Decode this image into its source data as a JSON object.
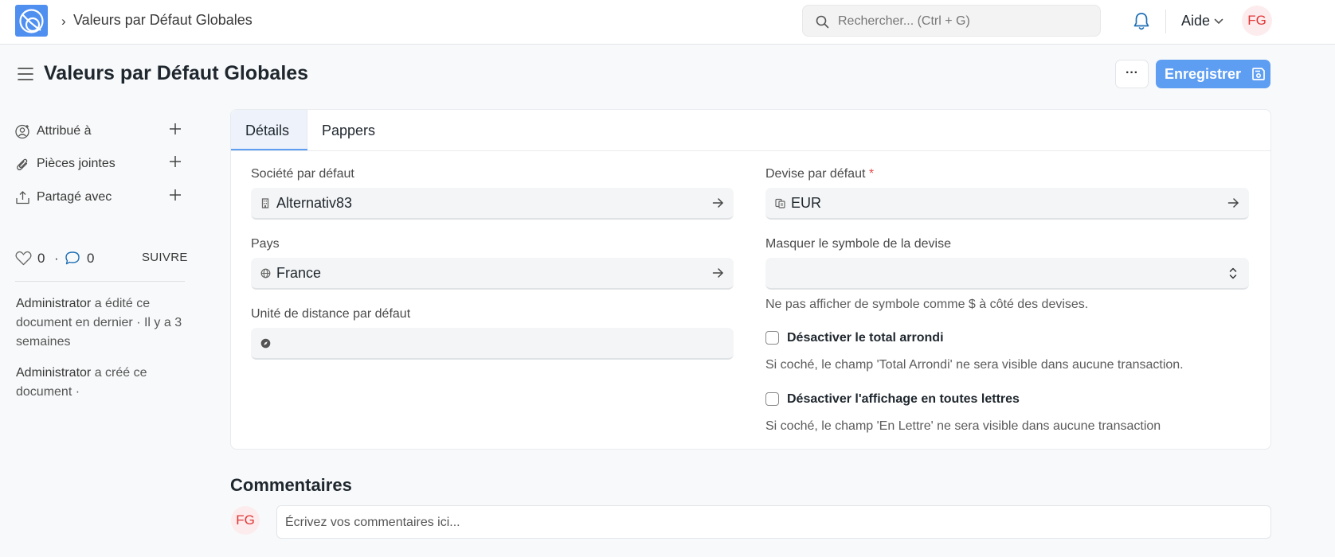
{
  "navbar": {
    "breadcrumb": "Valeurs par Défaut Globales",
    "search_placeholder": "Rechercher... (Ctrl + G)",
    "help_label": "Aide",
    "user_initials": "FG"
  },
  "header": {
    "title": "Valeurs par Défaut Globales",
    "more_label": "···",
    "save_label": "Enregistrer"
  },
  "sidebar": {
    "items": [
      {
        "label": "Attribué à"
      },
      {
        "label": "Pièces jointes"
      },
      {
        "label": "Partagé avec"
      }
    ],
    "likes_count": "0",
    "comments_count": "0",
    "follow_label": "SUIVRE",
    "activity": [
      {
        "user": "Administrator",
        "text": "a édité ce document en dernier · Il y a 3 semaines"
      },
      {
        "user": "Administrator",
        "text": "a créé ce document ·"
      }
    ]
  },
  "tabs": [
    {
      "label": "Détails",
      "active": true
    },
    {
      "label": "Pappers",
      "active": false
    }
  ],
  "form": {
    "company": {
      "label": "Société par défaut",
      "value": "Alternativ83"
    },
    "country": {
      "label": "Pays",
      "value": "France"
    },
    "distance_unit": {
      "label": "Unité de distance par défaut",
      "value": ""
    },
    "currency": {
      "label": "Devise par défaut",
      "required_mark": "*",
      "value": "EUR"
    },
    "hide_symbol": {
      "label": "Masquer le symbole de la devise",
      "value": "",
      "hint": "Ne pas afficher de symbole comme $ à côté des devises."
    },
    "disable_rounded": {
      "label": "Désactiver le total arrondi",
      "checked": false,
      "hint": "Si coché, le champ 'Total Arrondi' ne sera visible dans aucune transaction."
    },
    "disable_in_words": {
      "label": "Désactiver l'affichage en toutes lettres",
      "checked": false,
      "hint": "Si coché, le champ 'En Lettre' ne sera visible dans aucune transaction"
    }
  },
  "comments": {
    "title": "Commentaires",
    "user_initials": "FG",
    "placeholder": "Écrivez vos commentaires ici..."
  },
  "colors": {
    "primary": "#5e9ef2",
    "logo": "#4f8ff0",
    "avatar_text": "#e03636",
    "required": "#e24c4c"
  }
}
